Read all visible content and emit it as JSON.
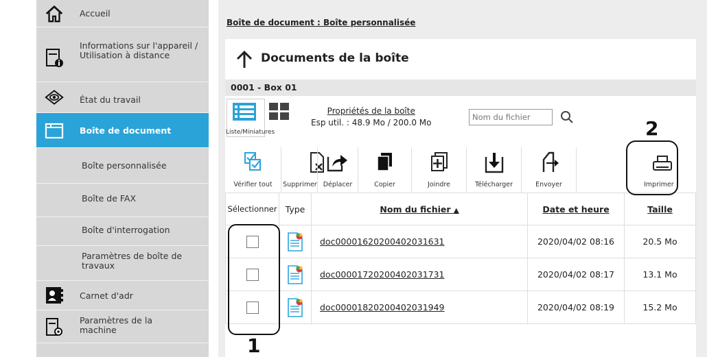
{
  "sidebar": {
    "items": [
      {
        "label": "Accueil",
        "icon": "home-icon"
      },
      {
        "label": "Informations sur l'appareil / Utilisation à distance",
        "icon": "device-info-icon"
      },
      {
        "label": "État du travail",
        "icon": "eye-icon"
      },
      {
        "label": "Boîte de document",
        "icon": "folder-icon",
        "active": true
      }
    ],
    "sub_items": [
      {
        "label": "Boîte personnalisée"
      },
      {
        "label": "Boîte de FAX"
      },
      {
        "label": "Boîte d'interrogation"
      },
      {
        "label": "Paramètres de boîte de travaux"
      }
    ],
    "bottom_items": [
      {
        "label": "Carnet d'adr",
        "icon": "address-book-icon"
      },
      {
        "label": "Paramètres de la machine",
        "icon": "machine-settings-icon"
      }
    ]
  },
  "breadcrumb": "Boîte de document : Boîte personnalisée",
  "panel": {
    "title": "Documents de la boîte",
    "box_name": "0001 - Box 01",
    "view_toggle_label": "Liste/Miniatures",
    "properties_link": "Propriétés de la boîte",
    "usage": "Esp util. : 48.9 Mo / 200.0 Mo",
    "search_placeholder": "Nom du fichier"
  },
  "toolbar": [
    {
      "label": "Vérifier tout",
      "icon": "check-all-icon"
    },
    {
      "label": "Supprimer",
      "icon": "delete-icon"
    },
    {
      "label": "Déplacer",
      "icon": "move-icon"
    },
    {
      "label": "Copier",
      "icon": "copy-icon"
    },
    {
      "label": "Joindre",
      "icon": "join-icon"
    },
    {
      "label": "Télécharger",
      "icon": "download-icon"
    },
    {
      "label": "Envoyer",
      "icon": "send-icon"
    },
    {
      "label": "Imprimer",
      "icon": "print-icon"
    }
  ],
  "table": {
    "headers": {
      "select": "Sélectionner",
      "type": "Type",
      "name": "Nom du fichier",
      "date": "Date et heure",
      "size": "Taille"
    },
    "rows": [
      {
        "name": "doc00001620200402031631",
        "date": "2020/04/02 08:16",
        "size": "20.5 Mo"
      },
      {
        "name": "doc00001720200402031731",
        "date": "2020/04/02 08:17",
        "size": "13.1 Mo"
      },
      {
        "name": "doc00001820200402031949",
        "date": "2020/04/02 08:19",
        "size": "15.2 Mo"
      }
    ]
  },
  "callouts": {
    "one": "1",
    "two": "2"
  },
  "colors": {
    "accent": "#2aa3d8",
    "sidebar": "#d7d7d7"
  }
}
